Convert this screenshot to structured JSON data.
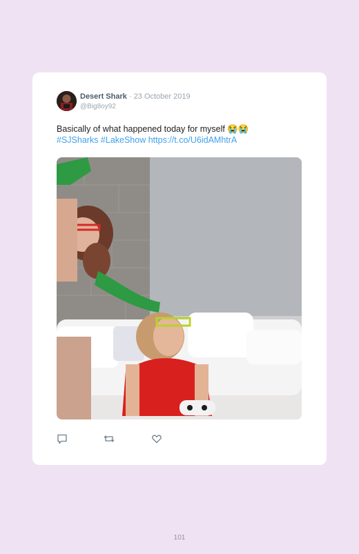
{
  "tweet": {
    "display_name": "Desert Shark",
    "date": "· 23 October 2019",
    "handle": "@Big8oy92",
    "text_line1": "Basically of what happened today for myself 😭😭",
    "hashtags": "#SJSharks #LakeShow",
    "link": "https://t.co/U6idAMhtrA"
  },
  "actions": {
    "reply_icon": "reply-icon",
    "retweet_icon": "retweet-icon",
    "like_icon": "heart-icon"
  },
  "page": {
    "number": "101"
  },
  "colors": {
    "background": "#efe3f3",
    "card": "#ffffff",
    "link": "#3fa0ea"
  }
}
